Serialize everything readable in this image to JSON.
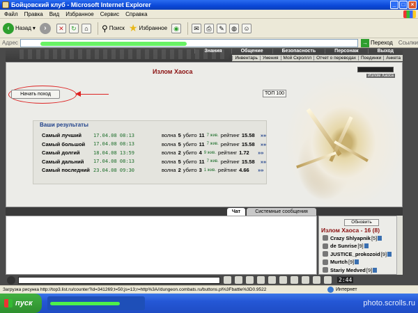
{
  "window": {
    "title": "Бойцовский клуб - Microsoft Internet Explorer"
  },
  "menu": [
    "Файл",
    "Правка",
    "Вид",
    "Избранное",
    "Сервис",
    "Справка"
  ],
  "toolbar": {
    "back": "Назад",
    "search": "Поиск",
    "favorites": "Избранное"
  },
  "address": {
    "label": "Адрес",
    "go": "Переход",
    "links": "Ссылки"
  },
  "game": {
    "nav_top": [
      "Знания",
      "Общение",
      "Безопасность",
      "Персонаж",
      "Выход"
    ],
    "nav_bottom": [
      "Инвентарь",
      "Умения",
      "Мой Скроллл",
      "Отчет о переводах",
      "Поединки",
      "Анкета"
    ],
    "page_title": "Излом Хаоса",
    "mini_label": "Излом Хаоса",
    "start_button": "Начать поход",
    "top_button": "ТОП 100",
    "results": {
      "title": "Ваши результаты",
      "rows": [
        {
          "label": "Самый лучший",
          "date": "17.04.08 08:13",
          "wave": "5",
          "killed": "11",
          "kills_word": "7 жив.",
          "rating": "15.58"
        },
        {
          "label": "Самый большой",
          "date": "17.04.08 08:13",
          "wave": "5",
          "killed": "11",
          "kills_word": "7 жив.",
          "rating": "15.58"
        },
        {
          "label": "Самый долгий",
          "date": "18.04.08 13:59",
          "wave": "2",
          "killed": "4",
          "kills_word": "9 жив.",
          "rating": "1.72"
        },
        {
          "label": "Самый дальний",
          "date": "17.04.08 08:13",
          "wave": "5",
          "killed": "11",
          "kills_word": "7 жив.",
          "rating": "15.58"
        },
        {
          "label": "Самый последний",
          "date": "23.04.08 09:30",
          "wave": "2",
          "killed": "3",
          "kills_word": "1 жив.",
          "rating": "4.66"
        }
      ],
      "words": {
        "wave": "волна",
        "killed": "убито",
        "rating": "рейтинг",
        "more": "»»"
      }
    },
    "tabs": {
      "chat": "Чат",
      "system": "Системные сообщения"
    },
    "side": {
      "refresh": "Обновить",
      "room": "Излом Хаоса - 16 (8)",
      "players": [
        {
          "name": "Crazy Shlyapnik",
          "level": "[5]"
        },
        {
          "name": "de Sunrise",
          "level": "[9]"
        },
        {
          "name": "JUSTICE_prokozoid",
          "level": "[9]"
        },
        {
          "name": "Murtch",
          "level": "[9]"
        },
        {
          "name": "Stariy Medved",
          "level": "[9]"
        }
      ]
    },
    "clock": "2:44"
  },
  "status": {
    "text": "Загрузка рисунка http://top3.list.ru/counter?id=341269;t=50;js=13;r=http%3A//dungeon.combats.ru/buttons.pl%3Fbattle%3D0.9522",
    "zone": "Интернет"
  },
  "taskbar": {
    "start": "пуск",
    "watermark": "photo.scrolls.ru"
  }
}
